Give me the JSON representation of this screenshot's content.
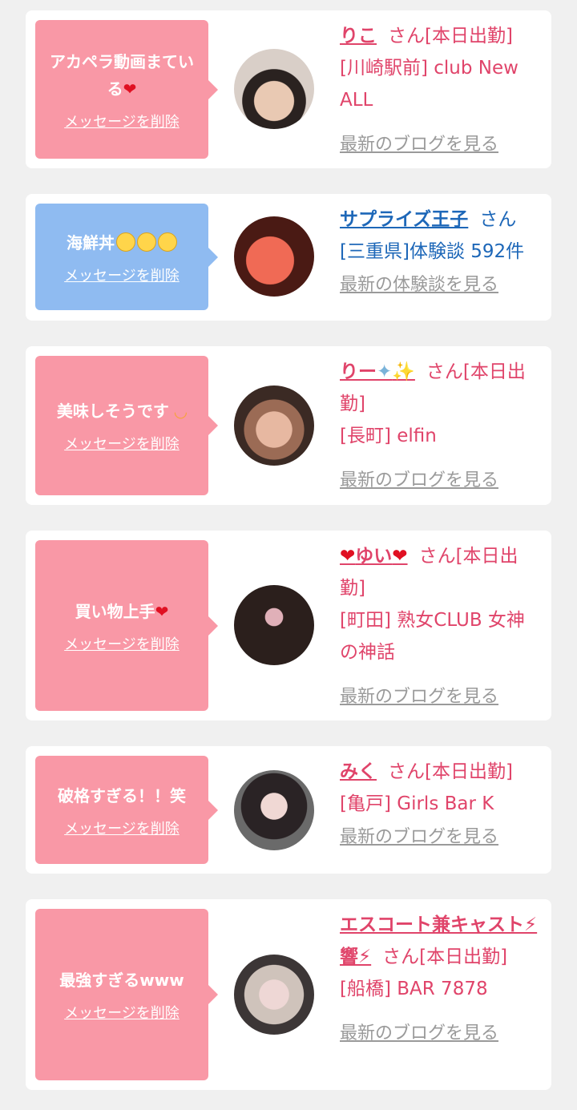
{
  "items": [
    {
      "message": "アカペラ動画まている",
      "delete_label": "メッセージを削除",
      "name": "りこ",
      "suffix": "さん[本日出勤]",
      "place": "[川崎駅前] club New ALL",
      "more": "最新のブログを見る"
    },
    {
      "message": "海鮮丼",
      "delete_label": "メッセージを削除",
      "name": "サプライズ王子",
      "suffix": "さん",
      "place": "[三重県]体験談 592件",
      "more": "最新の体験談を見る"
    },
    {
      "message": "美味しそうです",
      "delete_label": "メッセージを削除",
      "name": "りー",
      "suffix": "さん[本日出勤]",
      "place": "[長町] elfin",
      "more": "最新のブログを見る"
    },
    {
      "message": "買い物上手",
      "delete_label": "メッセージを削除",
      "name": "ゆい",
      "suffix": "さん[本日出勤]",
      "place": "[町田] 熟女CLUB 女神の神話",
      "more": "最新のブログを見る"
    },
    {
      "message": "破格すぎる！！笑",
      "delete_label": "メッセージを削除",
      "name": "みく",
      "suffix": "さん[本日出勤]",
      "place": "[亀戸] Girls Bar K",
      "more": "最新のブログを見る"
    },
    {
      "message": "最強すぎるwww",
      "delete_label": "メッセージを削除",
      "name": "エスコート兼キャスト⚡響⚡",
      "suffix": "さん[本日出勤]",
      "place": "[船橋] BAR 7878",
      "more": "最新のブログを見る"
    }
  ],
  "colors": {
    "pink": "#f998a6",
    "blue": "#8fbbf1",
    "link_pink": "#e0446a",
    "link_blue": "#1d67b8",
    "muted": "#9a9a9a"
  }
}
